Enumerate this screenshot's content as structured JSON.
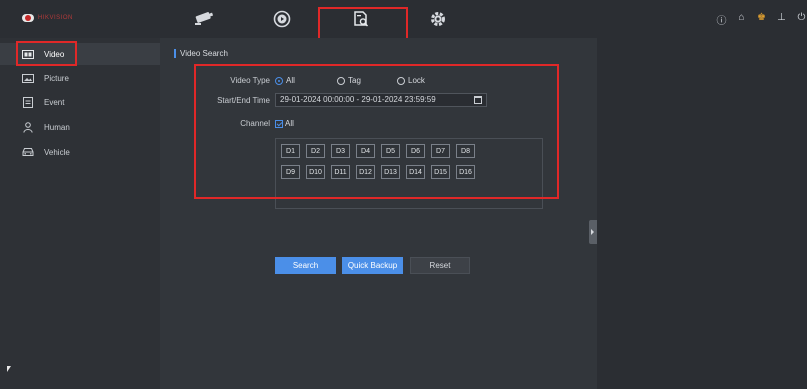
{
  "brand": {
    "logo_text": "HIKVISION",
    "accent": "#4b8fe8",
    "highlight": "#e02828"
  },
  "topnav": {
    "items": [
      {
        "icon": "camera-icon"
      },
      {
        "icon": "playback-icon"
      },
      {
        "icon": "file-search-icon"
      },
      {
        "icon": "gear-icon"
      }
    ],
    "system_icons": [
      "info-icon",
      "home-icon",
      "user-icon",
      "export-icon",
      "power-icon"
    ]
  },
  "sidebar": {
    "items": [
      {
        "label": "Video",
        "icon": "video-icon"
      },
      {
        "label": "Picture",
        "icon": "picture-icon"
      },
      {
        "label": "Event",
        "icon": "event-icon"
      },
      {
        "label": "Human",
        "icon": "human-icon"
      },
      {
        "label": "Vehicle",
        "icon": "vehicle-icon"
      }
    ]
  },
  "search": {
    "title": "Video Search",
    "video_type_label": "Video Type",
    "video_type_options": [
      "All",
      "Tag",
      "Lock"
    ],
    "video_type_selected": "All",
    "time_label": "Start/End Time",
    "time_value": "29-01-2024 00:00:00 - 29-01-2024 23:59:59",
    "channel_label": "Channel",
    "channel_all": "All",
    "channels_row1": [
      "D1",
      "D2",
      "D3",
      "D4",
      "D5",
      "D6",
      "D7",
      "D8"
    ],
    "channels_row2": [
      "D9",
      "D10",
      "D11",
      "D12",
      "D13",
      "D14",
      "D15",
      "D16"
    ],
    "search_button": "Search",
    "backup_button": "Quick Backup",
    "reset_button": "Reset"
  }
}
